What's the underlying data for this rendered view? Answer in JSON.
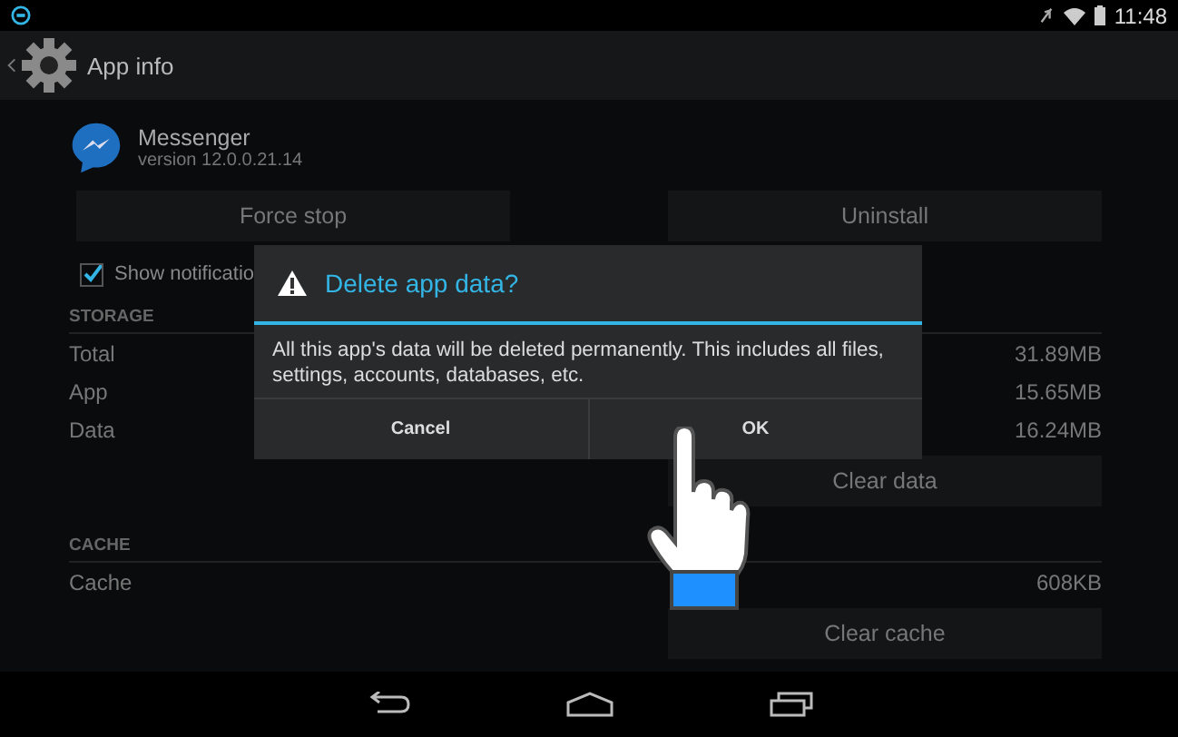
{
  "status_bar": {
    "time": "11:48"
  },
  "app_bar": {
    "title": "App info"
  },
  "app": {
    "name": "Messenger",
    "version": "version 12.0.0.21.14"
  },
  "actions": [
    {
      "label": "Force stop"
    },
    {
      "label": "Uninstall"
    }
  ],
  "notifications": {
    "label": "Show notificatio",
    "checked": true
  },
  "storage": {
    "header": "STORAGE",
    "rows": [
      {
        "label": "Total",
        "value": "31.89MB"
      },
      {
        "label": "App",
        "value": "15.65MB"
      },
      {
        "label": "Data",
        "value": "16.24MB"
      }
    ],
    "button": "Clear data"
  },
  "cache": {
    "header": "CACHE",
    "rows": [
      {
        "label": "Cache",
        "value": "608KB"
      }
    ],
    "button": "Clear cache"
  },
  "dialog": {
    "title": "Delete app data?",
    "message": "All this app's data will be deleted permanently. This includes all files, settings, accounts, databases, etc.",
    "buttons": [
      {
        "label": "Cancel"
      },
      {
        "label": "OK"
      }
    ]
  }
}
